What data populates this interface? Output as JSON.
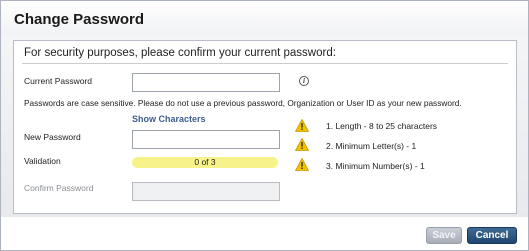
{
  "dialog": {
    "title": "Change Password",
    "intro": "For security purposes, please confirm your current password:",
    "current_password_label": "Current Password",
    "note": "Passwords are case sensitive. Please do not use a previous password, Organization or User ID as your new password.",
    "show_characters": "Show Characters",
    "new_password_label": "New Password",
    "validation_label": "Validation",
    "validation_progress": "0 of 3",
    "validation_passed": 0,
    "validation_total": 3,
    "confirm_password_label": "Confirm Password",
    "info_icon": "info-icon",
    "requirements": [
      {
        "text": "1. Length - 8 to 25 characters",
        "icon": "warning-icon"
      },
      {
        "text": "2. Minimum Letter(s) - 1",
        "icon": "warning-icon"
      },
      {
        "text": "3. Minimum Number(s) - 1",
        "icon": "warning-icon"
      }
    ]
  },
  "buttons": {
    "save": "Save",
    "cancel": "Cancel"
  },
  "colors": {
    "meter": "#f7f38a",
    "warning": "#f2c200",
    "cancel_button": "#1f4670",
    "link": "#3d5f8f"
  }
}
